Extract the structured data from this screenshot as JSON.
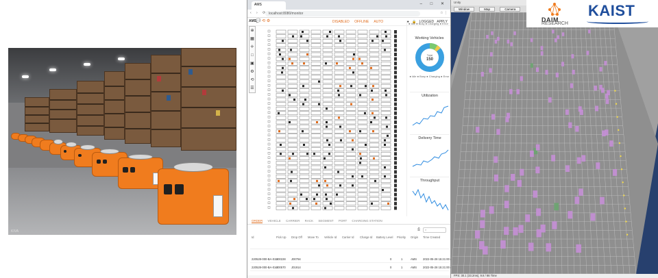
{
  "photo": {
    "caption": "KIVA"
  },
  "browser": {
    "tab_title": "AMS",
    "url": "localhost:8080/monitor",
    "nav_icons": "‹ › ⟳",
    "ext_icons": "☆ ⋮",
    "window_controls": "– □ ✕",
    "brand": "AMS",
    "header_icons": "💬 ⟲ ⚙",
    "modes": [
      "DISABLED",
      "OFFLINE",
      "AUTO"
    ],
    "header_right": "● 🔒 LOGGED  APPLY",
    "toolbar_icons": [
      "⊕",
      "▦",
      "✛",
      "□",
      "▣",
      "⚙",
      "⟲",
      "☰"
    ],
    "side_panel": {
      "legend_top": "● Idle  ● Busy  ● Charging  ● Error",
      "working_vehicles_title": "Working Vehicles",
      "donut_label": "Total",
      "donut_value": "150",
      "legend_bottom": "● Idle  ● Busy  ● Charging  ● Error",
      "utilization_title": "Utilization",
      "delivery_time_title": "Delivery Time",
      "throughput_title": "Throughput"
    },
    "bottom_tabs": [
      "ORDER",
      "VEHICLE",
      "CARRIER",
      "RACK",
      "SEGMENT",
      "PORT",
      "CHARGING STATION"
    ],
    "table_headers": [
      "Id",
      "Pick Up",
      "Drop Off",
      "Move To",
      "Vehicle Id",
      "Carrier Id",
      "Charge Id",
      "Battery Level",
      "Priority",
      "Origin",
      "Time Created"
    ],
    "rows": [
      [
        "220528-000-BA-015",
        "J00228",
        "J00794",
        "",
        "",
        "",
        "",
        "0",
        "1",
        "AMS",
        "2022-05-28 15:21:00 AM"
      ],
      [
        "220528-000-BA-016",
        "J00570",
        "J01914",
        "",
        "",
        "",
        "",
        "0",
        "1",
        "AMS",
        "2022-05-28 15:21:00 AM"
      ]
    ]
  },
  "sim": {
    "title": "Unity",
    "menu": [
      "Window",
      "Map",
      "Camera"
    ],
    "status": "FPS: 30.1 (33.2ms), 9.8 / 86 Time"
  },
  "logos": {
    "daim": "DAIM",
    "research": "RESEARCH",
    "kaist": "KAIST"
  },
  "colors": {
    "accent": "#e06a1a",
    "kaist_blue": "#1f4e9c",
    "robot_orange": "#f07c1e",
    "sim_robot": "#c58fd6"
  }
}
